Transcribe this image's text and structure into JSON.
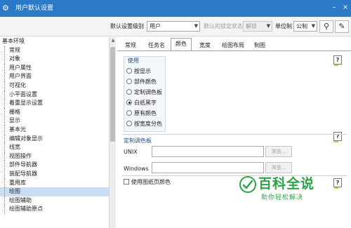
{
  "window": {
    "title": "用户默认设置"
  },
  "toolbar": {
    "default_level_label": "默认设置级别",
    "default_level_value": "用户",
    "lock_state_label": "默认的锁定状态",
    "lock_state_value": "解锁",
    "unit_label": "单位制",
    "unit_value": "公制"
  },
  "tree": {
    "items": [
      {
        "label": "基本环境",
        "level": 0
      },
      {
        "label": "常规",
        "level": 1
      },
      {
        "label": "对象",
        "level": 1
      },
      {
        "label": "用户属性",
        "level": 1
      },
      {
        "label": "用户界面",
        "level": 1
      },
      {
        "label": "可视化",
        "level": 1
      },
      {
        "label": "小平面设置",
        "level": 1
      },
      {
        "label": "着重显示设置",
        "level": 1
      },
      {
        "label": "栅格",
        "level": 1
      },
      {
        "label": "显示",
        "level": 1
      },
      {
        "label": "基本光",
        "level": 1
      },
      {
        "label": "编辑对象显示",
        "level": 1
      },
      {
        "label": "线宽",
        "level": 1
      },
      {
        "label": "视图操作",
        "level": 1
      },
      {
        "label": "部件导航器",
        "level": 1
      },
      {
        "label": "装配导航器",
        "level": 1
      },
      {
        "label": "重用库",
        "level": 1
      },
      {
        "label": "绘图",
        "level": 1,
        "selected": true
      },
      {
        "label": "绘图辅助",
        "level": 1
      },
      {
        "label": "绘图辅助原点",
        "level": 1
      }
    ]
  },
  "tabs": [
    {
      "label": "常规"
    },
    {
      "label": "任务名"
    },
    {
      "label": "颜色",
      "active": true
    },
    {
      "label": "宽度"
    },
    {
      "label": "绘图布局"
    },
    {
      "label": "制图"
    }
  ],
  "use_group": {
    "title": "使用",
    "options": [
      {
        "label": "按显示",
        "selected": false
      },
      {
        "label": "部件颜色",
        "selected": false
      },
      {
        "label": "定制调色板",
        "selected": false
      },
      {
        "label": "白纸黑字",
        "selected": true
      },
      {
        "label": "原有颜色",
        "selected": false
      },
      {
        "label": "按宽度分色",
        "selected": false
      }
    ]
  },
  "palette": {
    "title": "定制调色板",
    "unix_label": "UNIX",
    "unix_value": "",
    "windows_label": "Windows",
    "windows_value": "",
    "browse_label": "浏览..."
  },
  "checkbox": {
    "label": "使用图纸页颜色",
    "checked": false
  },
  "watermark": {
    "title": "百科全说",
    "subtitle": "助你轻松解决"
  },
  "colors": {
    "titlebar": "#2a7ac8",
    "selected_row": "#c9def5",
    "group_title": "#1f4f8c",
    "watermark": "#2ba346"
  }
}
